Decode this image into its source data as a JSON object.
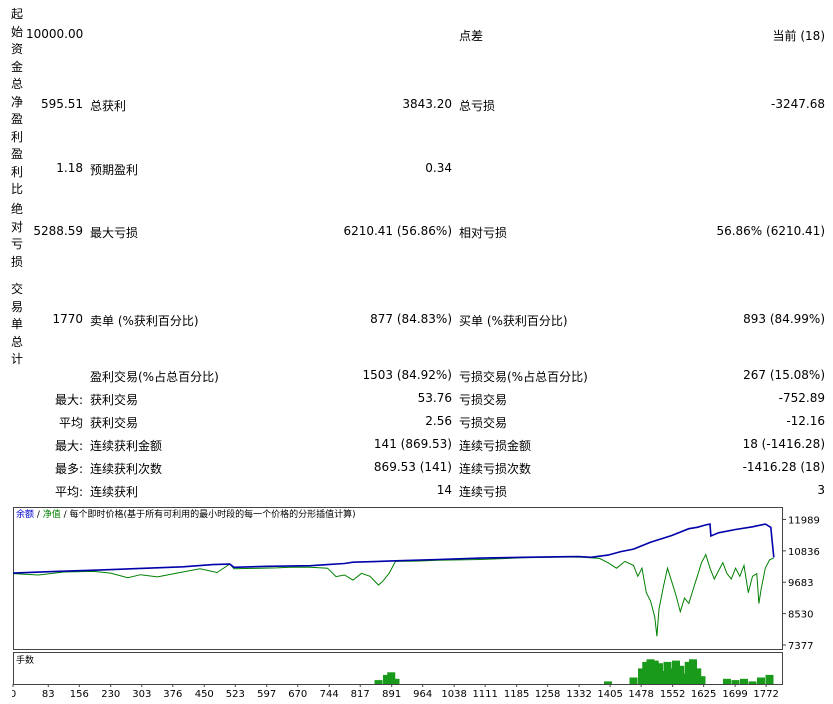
{
  "report": {
    "rows": [
      {
        "label": "起始资金",
        "v1": "10000.00",
        "c2": "",
        "v2": "",
        "c3": "点差",
        "v3": "当前 (18)"
      },
      {
        "label": "总净盈利",
        "v1": "595.51",
        "c2": "总获利",
        "v2": "3843.20",
        "c3": "总亏损",
        "v3": "-3247.68"
      },
      {
        "label": "盈利比",
        "v1": "1.18",
        "c2": "预期盈利",
        "v2": "0.34",
        "c3": "",
        "v3": ""
      },
      {
        "label": "绝对亏损",
        "v1": "5288.59",
        "c2": "最大亏损",
        "v2": "6210.41 (56.86%)",
        "c3": "相对亏损",
        "v3": "56.86% (6210.41)"
      },
      {
        "label": "交易单总计",
        "v1": "1770",
        "c2": "卖单 (%获利百分比)",
        "v2": "877 (84.83%)",
        "c3": "买单 (%获利百分比)",
        "v3": "893 (84.99%)"
      }
    ],
    "lower_rows": [
      {
        "pre": "",
        "c2": "盈利交易(%占总百分比)",
        "v2": "1503 (84.92%)",
        "c3": "亏损交易(%占总百分比)",
        "v3": "267 (15.08%)"
      },
      {
        "pre": "最大:",
        "c2": "获利交易",
        "v2": "53.76",
        "c3": "亏损交易",
        "v3": "-752.89"
      },
      {
        "pre": "平均",
        "c2": "获利交易",
        "v2": "2.56",
        "c3": "亏损交易",
        "v3": "-12.16"
      },
      {
        "pre": "最大:",
        "c2": "连续获利金额",
        "v2": "141 (869.53)",
        "c3": "连续亏损金额",
        "v3": "18 (-1416.28)"
      },
      {
        "pre": "最多:",
        "c2": "连续获利次数",
        "v2": "869.53 (141)",
        "c3": "连续亏损次数",
        "v3": "-1416.28 (18)"
      },
      {
        "pre": "平均:",
        "c2": "连续获利",
        "v2": "14",
        "c3": "连续亏损",
        "v3": "3"
      }
    ]
  },
  "chart": {
    "legend_balance": "余额",
    "legend_sep": " / ",
    "legend_equity": "净值",
    "legend_desc": " / 每个即时价格(基于所有可利用的最小时段的每一个价格的分形插值计算)",
    "volume_label": "手数",
    "colors": {
      "balance": "#0000aa",
      "equity": "#008000",
      "legend_balance": "#0000cc",
      "legend_equity": "#008000"
    }
  },
  "chart_data": {
    "type": "line",
    "yticks": [
      "11989",
      "10836",
      "9683",
      "8530",
      "7377"
    ],
    "xticks": [
      "0",
      "83",
      "156",
      "230",
      "303",
      "376",
      "450",
      "523",
      "597",
      "670",
      "744",
      "817",
      "891",
      "964",
      "1038",
      "1111",
      "1185",
      "1258",
      "1332",
      "1405",
      "1478",
      "1552",
      "1625",
      "1699",
      "1772"
    ],
    "ylim": [
      7377,
      12300
    ],
    "xlim": [
      0,
      1800
    ],
    "series": [
      {
        "name": "余额",
        "values": [
          [
            0,
            10020
          ],
          [
            100,
            10080
          ],
          [
            200,
            10130
          ],
          [
            300,
            10190
          ],
          [
            400,
            10250
          ],
          [
            470,
            10330
          ],
          [
            510,
            10350
          ],
          [
            520,
            10230
          ],
          [
            600,
            10270
          ],
          [
            700,
            10290
          ],
          [
            740,
            10330
          ],
          [
            780,
            10370
          ],
          [
            800,
            10420
          ],
          [
            850,
            10440
          ],
          [
            900,
            10470
          ],
          [
            1000,
            10520
          ],
          [
            1100,
            10570
          ],
          [
            1200,
            10600
          ],
          [
            1300,
            10620
          ],
          [
            1330,
            10630
          ],
          [
            1360,
            10600
          ],
          [
            1400,
            10680
          ],
          [
            1430,
            10810
          ],
          [
            1460,
            10900
          ],
          [
            1500,
            11150
          ],
          [
            1550,
            11400
          ],
          [
            1590,
            11650
          ],
          [
            1610,
            11700
          ],
          [
            1630,
            11790
          ],
          [
            1640,
            11820
          ],
          [
            1642,
            11380
          ],
          [
            1660,
            11500
          ],
          [
            1700,
            11620
          ],
          [
            1740,
            11720
          ],
          [
            1770,
            11820
          ],
          [
            1783,
            11700
          ],
          [
            1786,
            11250
          ],
          [
            1790,
            10600
          ]
        ]
      },
      {
        "name": "净值",
        "values": [
          [
            0,
            10000
          ],
          [
            60,
            9950
          ],
          [
            120,
            10060
          ],
          [
            190,
            10080
          ],
          [
            230,
            10020
          ],
          [
            270,
            9850
          ],
          [
            300,
            9960
          ],
          [
            340,
            9880
          ],
          [
            390,
            10030
          ],
          [
            440,
            10180
          ],
          [
            480,
            10040
          ],
          [
            510,
            10350
          ],
          [
            520,
            10180
          ],
          [
            560,
            10190
          ],
          [
            620,
            10210
          ],
          [
            660,
            10240
          ],
          [
            700,
            10230
          ],
          [
            740,
            10200
          ],
          [
            760,
            9890
          ],
          [
            780,
            9950
          ],
          [
            800,
            9760
          ],
          [
            820,
            10010
          ],
          [
            840,
            9900
          ],
          [
            860,
            9580
          ],
          [
            870,
            9720
          ],
          [
            885,
            10010
          ],
          [
            900,
            10450
          ],
          [
            950,
            10460
          ],
          [
            1000,
            10490
          ],
          [
            1100,
            10520
          ],
          [
            1200,
            10580
          ],
          [
            1300,
            10610
          ],
          [
            1340,
            10600
          ],
          [
            1380,
            10560
          ],
          [
            1400,
            10400
          ],
          [
            1420,
            10200
          ],
          [
            1440,
            10450
          ],
          [
            1460,
            10300
          ],
          [
            1470,
            9900
          ],
          [
            1480,
            10200
          ],
          [
            1490,
            9300
          ],
          [
            1500,
            9000
          ],
          [
            1510,
            8400
          ],
          [
            1515,
            7700
          ],
          [
            1520,
            8700
          ],
          [
            1530,
            9500
          ],
          [
            1540,
            10200
          ],
          [
            1550,
            9700
          ],
          [
            1560,
            9200
          ],
          [
            1570,
            8600
          ],
          [
            1580,
            9100
          ],
          [
            1590,
            8900
          ],
          [
            1600,
            9400
          ],
          [
            1610,
            9900
          ],
          [
            1620,
            10400
          ],
          [
            1630,
            10700
          ],
          [
            1640,
            10200
          ],
          [
            1650,
            9800
          ],
          [
            1660,
            10100
          ],
          [
            1670,
            10400
          ],
          [
            1680,
            10000
          ],
          [
            1690,
            9800
          ],
          [
            1700,
            10200
          ],
          [
            1710,
            9900
          ],
          [
            1720,
            10300
          ],
          [
            1730,
            9300
          ],
          [
            1740,
            9900
          ],
          [
            1750,
            10000
          ],
          [
            1755,
            8900
          ],
          [
            1760,
            9400
          ],
          [
            1770,
            10200
          ],
          [
            1780,
            10500
          ],
          [
            1790,
            10580
          ]
        ]
      }
    ],
    "volume": [
      [
        860,
        0.15
      ],
      [
        880,
        0.35
      ],
      [
        890,
        0.45
      ],
      [
        900,
        0.2
      ],
      [
        1400,
        0.1
      ],
      [
        1460,
        0.25
      ],
      [
        1480,
        0.6
      ],
      [
        1490,
        0.85
      ],
      [
        1500,
        0.95
      ],
      [
        1510,
        0.9
      ],
      [
        1520,
        0.8
      ],
      [
        1530,
        0.5
      ],
      [
        1540,
        0.85
      ],
      [
        1550,
        0.6
      ],
      [
        1560,
        0.9
      ],
      [
        1570,
        0.7
      ],
      [
        1580,
        0.4
      ],
      [
        1590,
        0.85
      ],
      [
        1600,
        0.95
      ],
      [
        1610,
        0.6
      ],
      [
        1620,
        0.3
      ],
      [
        1680,
        0.2
      ],
      [
        1700,
        0.15
      ],
      [
        1720,
        0.2
      ],
      [
        1740,
        0.1
      ],
      [
        1760,
        0.25
      ],
      [
        1780,
        0.35
      ]
    ]
  }
}
